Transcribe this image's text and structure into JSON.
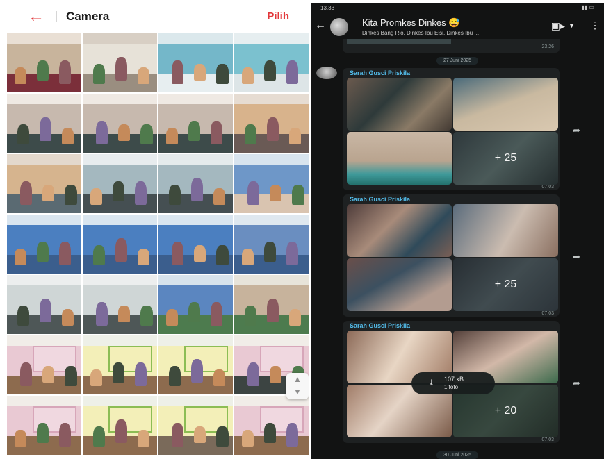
{
  "gallery": {
    "title": "Camera",
    "back_icon": "back-arrow-icon",
    "pick_label": "Pilih",
    "accent": "#e2373a",
    "scroll_icon": "scroll-handle-icon"
  },
  "chat": {
    "status_time": "13.33",
    "title": "Kita Promkes Dinkes 😅",
    "subtitle": "Dinkes Bang Rio, Dinkes Ibu Elsi, Dinkes Ibu ...",
    "prev_time": "23.26",
    "date_1": "27 Juni 2025",
    "date_2": "30 Juni 2025",
    "messages": [
      {
        "sender": "Sarah Gusci Priskila",
        "more": "+ 25",
        "time": "07.03"
      },
      {
        "sender": "Sarah Gusci Priskila",
        "more": "+ 25",
        "time": "07.03"
      },
      {
        "sender": "Sarah Gusci Priskila",
        "more": "+ 20",
        "time": "07.03"
      }
    ],
    "download": {
      "size": "107 kB",
      "count": "1 foto"
    },
    "sender_color": "#53bdeb"
  }
}
